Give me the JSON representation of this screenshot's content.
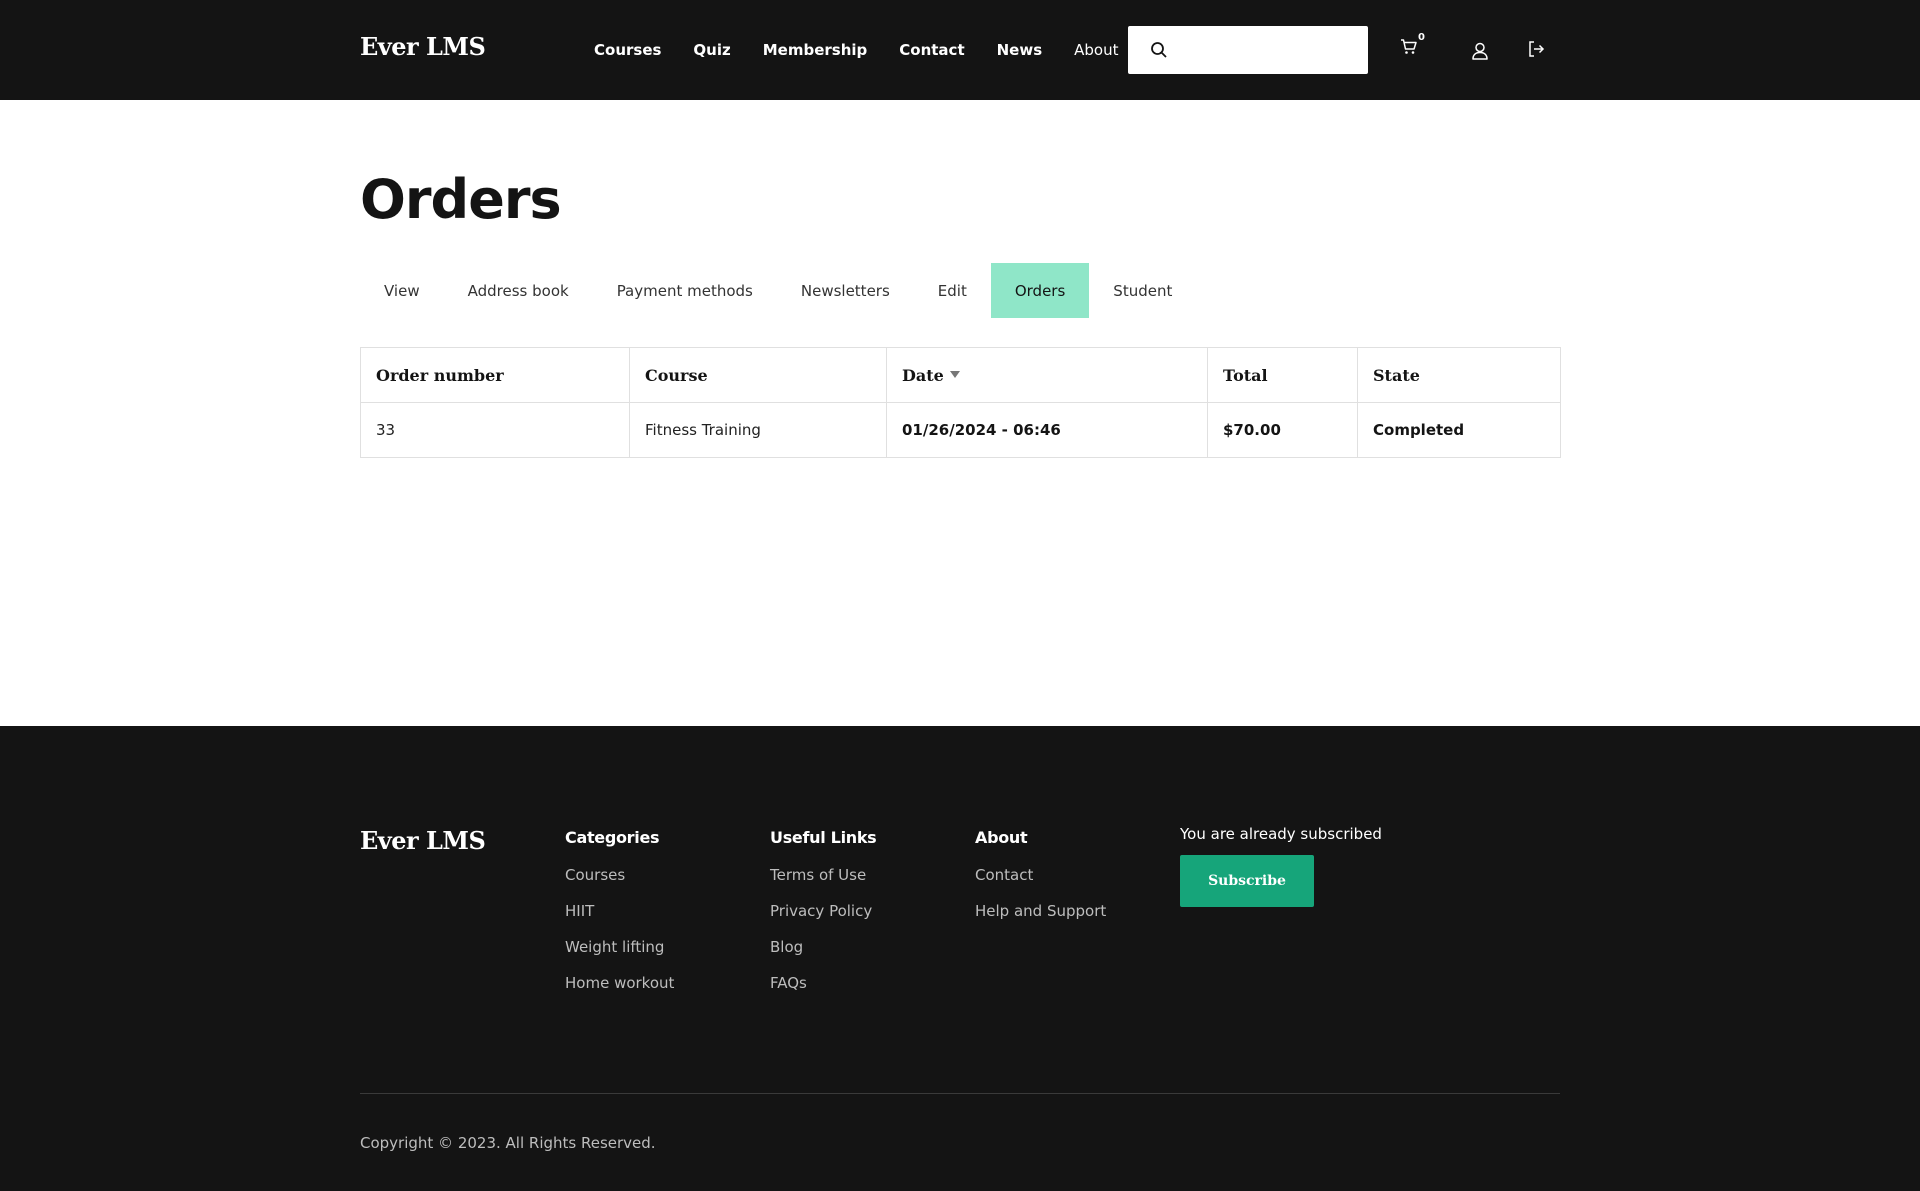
{
  "header": {
    "logo": "Ever LMS",
    "nav": [
      {
        "label": "Courses"
      },
      {
        "label": "Quiz"
      },
      {
        "label": "Membership"
      },
      {
        "label": "Contact"
      },
      {
        "label": "News"
      },
      {
        "label": "About"
      }
    ],
    "search": {
      "placeholder": ""
    },
    "cart_count": "0"
  },
  "main": {
    "title": "Orders",
    "tabs": [
      {
        "label": "View",
        "active": false
      },
      {
        "label": "Address book",
        "active": false
      },
      {
        "label": "Payment methods",
        "active": false
      },
      {
        "label": "Newsletters",
        "active": false
      },
      {
        "label": "Edit",
        "active": false
      },
      {
        "label": "Orders",
        "active": true
      },
      {
        "label": "Student",
        "active": false
      }
    ],
    "table": {
      "headers": [
        "Order number",
        "Course",
        "Date",
        "Total",
        "State"
      ],
      "rows": [
        {
          "order_number": "33",
          "course": "Fitness Training",
          "date": "01/26/2024 - 06:46",
          "total": "$70.00",
          "state": "Completed"
        }
      ]
    }
  },
  "footer": {
    "logo": "Ever LMS",
    "categories": {
      "title": "Categories",
      "links": [
        "Courses",
        "HIIT",
        "Weight lifting",
        "Home workout"
      ]
    },
    "useful_links": {
      "title": "Useful Links",
      "links": [
        "Terms of Use",
        "Privacy Policy",
        "Blog",
        "FAQs"
      ]
    },
    "about": {
      "title": "About",
      "links": [
        "Contact",
        "Help and Support"
      ]
    },
    "newsletter": {
      "status_text": "You are already subscribed",
      "subscribe_label": "Subscribe"
    },
    "copyright": "Copyright © 2023. All Rights Reserved."
  },
  "colors": {
    "dark": "#141414",
    "accent": "#16a57a",
    "active_tab": "#8fe6c8"
  }
}
